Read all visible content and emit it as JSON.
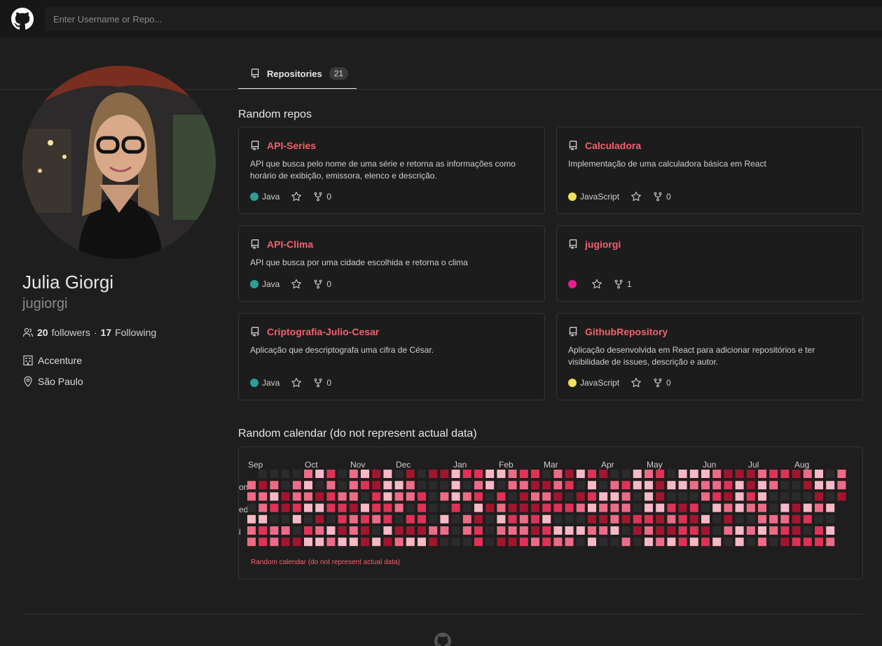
{
  "header": {
    "search_placeholder": "Enter Username or Repo...",
    "logo_icon": "github-icon"
  },
  "tabs": [
    {
      "label": "Repositories",
      "count": "21",
      "icon": "book-icon"
    }
  ],
  "profile": {
    "name": "Julia Giorgi",
    "login": "jugiorgi",
    "followers_count": "20",
    "followers_label": "followers",
    "separator": "·",
    "following_count": "17",
    "following_label": "Following",
    "company": "Accenture",
    "location": "São Paulo"
  },
  "repos_section": {
    "title": "Random repos",
    "repos": [
      {
        "name": "API-Series",
        "description": "API que busca pelo nome de uma série e retorna as informações como horário de exibição, emissora, elenco e descrição.",
        "language": "Java",
        "language_color": "#2b9e9a",
        "forks": "0"
      },
      {
        "name": "Calculadora",
        "description": "Implementação de uma calculadora básica em React",
        "language": "JavaScript",
        "language_color": "#f1e05a",
        "forks": "0"
      },
      {
        "name": "API-Clima",
        "description": "API que busca por uma cidade escolhida e retorna o clima",
        "language": "Java",
        "language_color": "#2b9e9a",
        "forks": "0"
      },
      {
        "name": "jugiorgi",
        "description": "",
        "language": "",
        "language_color": "#e81e8c",
        "forks": "1"
      },
      {
        "name": "Criptografia-Julio-Cesar",
        "description": "Aplicação que descriptografa uma cifra de César.",
        "language": "Java",
        "language_color": "#2b9e9a",
        "forks": "0"
      },
      {
        "name": "GithubRepository",
        "description": "Aplicação desenvolvida em React para adicionar repositórios e ter visibilidade de issues, descrição e autor.",
        "language": "JavaScript",
        "language_color": "#f1e05a",
        "forks": "0"
      }
    ]
  },
  "calendar": {
    "title": "Random calendar (do not represent actual data)",
    "caption": "Random calendar (do not represent actual data)",
    "months": [
      "Sep",
      "Oct",
      "Nov",
      "Dec",
      "Jan",
      "Feb",
      "Mar",
      "Apr",
      "May",
      "Jun",
      "Jul",
      "Aug"
    ],
    "day_labels": [
      "on",
      "ed",
      "i"
    ],
    "colors": [
      "#2b2b2b",
      "#f8b8c6",
      "#ee6b87",
      "#e03256",
      "#a3152e"
    ]
  }
}
